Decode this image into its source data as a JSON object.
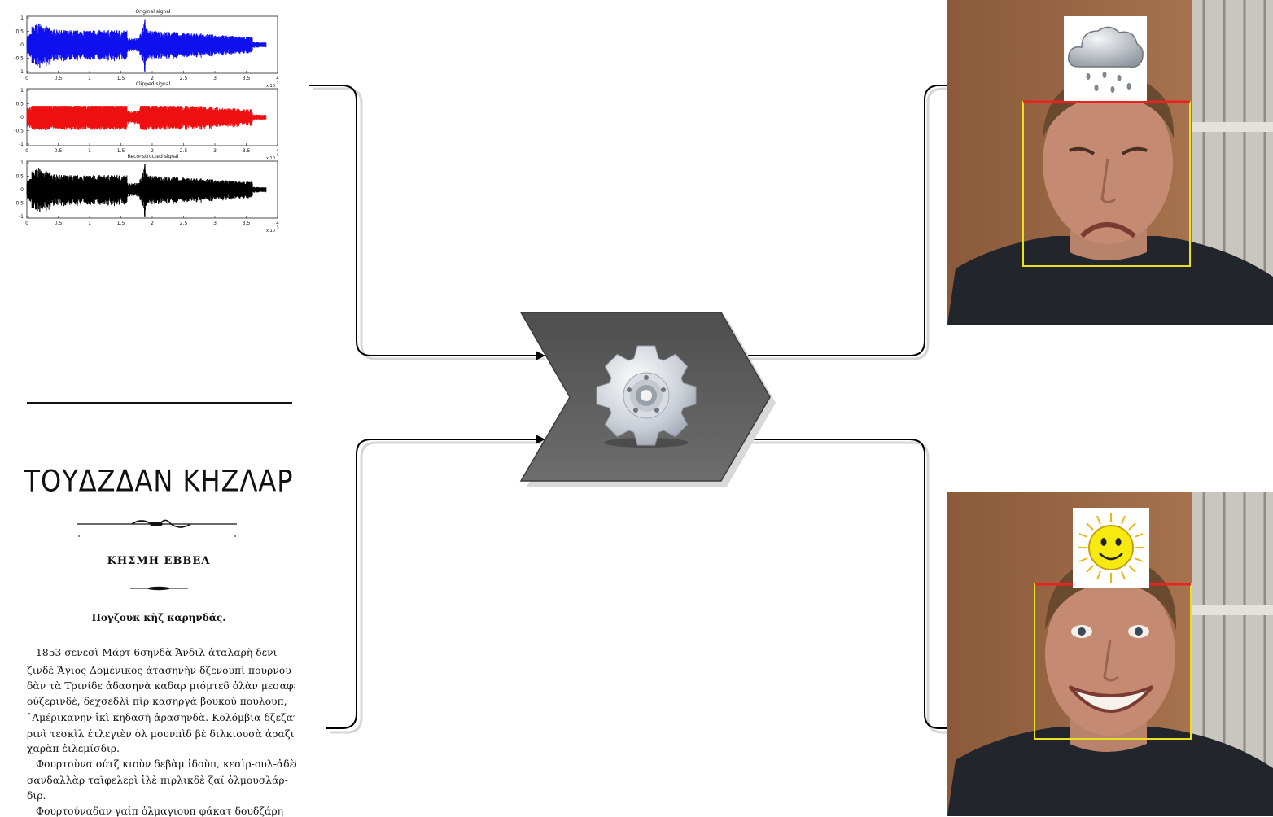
{
  "signal_panel": {
    "plots": [
      {
        "title": "Original signal",
        "color": "#1010ee"
      },
      {
        "title": "Clipped signal",
        "color": "#ee1010"
      },
      {
        "title": "Reconstructed signal",
        "color": "#000000"
      }
    ],
    "x_ticks": [
      "0",
      "0.5",
      "1",
      "1.5",
      "2",
      "2.5",
      "3",
      "3.5",
      "4"
    ],
    "y_ticks": [
      "1",
      "0.5",
      "0",
      "-0.5",
      "-1"
    ],
    "x_multiplier": "x 10",
    "x_multiplier_exp": "5"
  },
  "document": {
    "title": "ΤΟΥΔΖΔΑΝ ΚΗΖΛΑΡ",
    "subtitle": "ΚΗΣΜΗ ΕΒΒΕΛ",
    "heading": "Πογζουκ κὴζ καρηνδάς.",
    "lines": [
      "1853 σενεσὶ Μάρτ 6σηνδὰ Ἄνδιλ ἀταλαρὴ δενι-",
      "ζινδὲ Ἅγιος Δομένικος ἀτασηνὴν δζενουπὶ πουρνου-",
      "δὰν τὰ Τρινίδε ἀδασηνὰ καδαρ μιόμτεδ ὀλὰν μεσαφὲ",
      "οὐζερινδὲ, δεχσεδλὶ πὶρ κασηργὰ βουκοὺ πουλουπ,",
      "᾽Αμέρικανην ἰκὶ κηδασὴ ἀρασηνδὰ. Κολόμβια δζεζατ-",
      "ρινὶ τεσκὶλ ἐτλεγιὲν ὀλ μουνπὶδ βὲ διλκιουσὰ ἀραζιγὶ",
      "χαρὰπ ἐιλεμίσδιρ.",
      "Φουρτοὺνα ούτζ κιοὺν δεβὰμ ἰδοὺπ, κεσὶρ-ουλ-ἀδὲδ",
      "σανδαλλὰρ ταϊφελερὶ ἰλὲ πιρλικδὲ ζαϊ ὀλμουσλάρ-",
      "διρ.",
      "Φουρτούναδαν γαἱπ ὀλμαγιουπ φάκατ δουδζάρη"
    ]
  },
  "process_node": {
    "icon": "gear-icon",
    "fill": "#5e5e5e"
  },
  "outputs": [
    {
      "emotion": "sad",
      "weather_icon": "rain-cloud-icon"
    },
    {
      "emotion": "happy",
      "weather_icon": "sun-icon"
    }
  ],
  "colors": {
    "connector": "#000000",
    "face_box": "#e8e020",
    "face_box_top": "#ee2020"
  }
}
